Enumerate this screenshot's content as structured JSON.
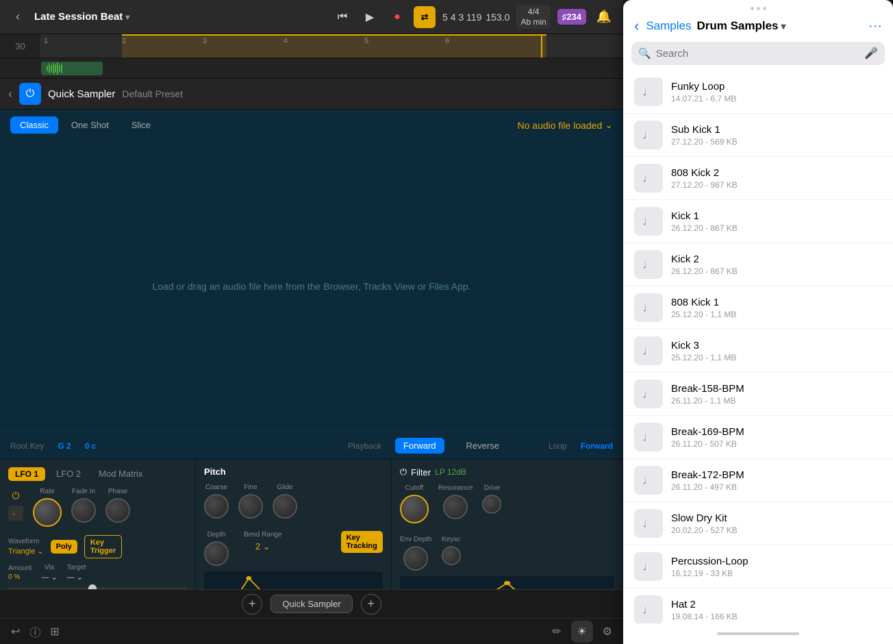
{
  "transport": {
    "back_label": "‹",
    "project_title": "Late Session Beat",
    "chevron": "▾",
    "rewind_icon": "⏮",
    "play_icon": "▶",
    "record_icon": "●",
    "loop_label": "⇄",
    "position": "5  4  3  119",
    "bpm": "153.0",
    "time_sig": "4/4\nAb min",
    "key_box": "♯234",
    "metronome_icon": "🔔"
  },
  "ruler": {
    "track_num": "30",
    "markers": [
      "1",
      "2",
      "3",
      "4",
      "5",
      "6"
    ]
  },
  "plugin": {
    "back_icon": "‹",
    "power_icon": "⏻",
    "name": "Quick Sampler",
    "preset": "Default Preset"
  },
  "sampler": {
    "tabs": [
      {
        "id": "classic",
        "label": "Classic",
        "active": true
      },
      {
        "id": "one-shot",
        "label": "One Shot",
        "active": false
      },
      {
        "id": "slice",
        "label": "Slice",
        "active": false
      }
    ],
    "no_audio": "No audio file loaded",
    "load_hint": "Load or drag an audio file here from the Browser, Tracks View or Files App.",
    "root_key_label": "Root Key",
    "root_key_value": "G 2",
    "tune_value": "0 c",
    "playback_label": "Playback",
    "forward_label": "Forward",
    "reverse_label": "Reverse",
    "loop_label": "Loop",
    "loop_value": "Forward"
  },
  "lfo": {
    "lfo1_label": "LFO 1",
    "lfo2_label": "LFO 2",
    "mod_matrix_label": "Mod Matrix",
    "rate_label": "Rate",
    "fade_in_label": "Fade In",
    "phase_label": "Phase",
    "waveform_label": "Waveform",
    "waveform_value": "Triangle",
    "poly_label": "Poly",
    "key_trigger_label": "Key\nTrigger",
    "amount_label": "Amount",
    "amount_value": "0 %",
    "via_label": "Via",
    "via_value": "—",
    "target_label": "Target",
    "target_value": "—"
  },
  "pitch": {
    "title": "Pitch",
    "coarse_label": "Coarse",
    "fine_label": "Fine",
    "glide_label": "Glide",
    "depth_label": "Depth",
    "bend_range_label": "Bend Range",
    "bend_range_value": "2",
    "key_tracking_label": "Key\nTracking"
  },
  "filter": {
    "title": "Filter",
    "type": "LP 12dB",
    "cutoff_label": "Cutoff",
    "resonance_label": "Resonance",
    "drive_label": "Drive",
    "env_depth_label": "Env Depth",
    "keysc_label": "Keysc"
  },
  "bottom_bar": {
    "add_left": "+",
    "track_label": "Quick Sampler",
    "add_right": "+",
    "undo_icon": "↩",
    "info_icon": "ⓘ",
    "layout_icon": "⊞",
    "pencil_icon": "✏",
    "brightness_icon": "☀",
    "eq_icon": "⚙"
  },
  "right_panel": {
    "dots": 3,
    "back_label": "Samples",
    "title": "Drum Samples",
    "title_chevron": "▾",
    "more_icon": "···",
    "search_placeholder": "Search",
    "mic_icon": "🎤",
    "samples": [
      {
        "name": "Funky Loop",
        "meta": "14.07.21 - 6,7 MB"
      },
      {
        "name": "Sub Kick 1",
        "meta": "27.12.20 - 569 KB"
      },
      {
        "name": "808 Kick 2",
        "meta": "27.12.20 - 987 KB"
      },
      {
        "name": "Kick 1",
        "meta": "26.12.20 - 867 KB"
      },
      {
        "name": "Kick 2",
        "meta": "26.12.20 - 867 KB"
      },
      {
        "name": "808 Kick 1",
        "meta": "25.12.20 - 1,1 MB"
      },
      {
        "name": "Kick 3",
        "meta": "25.12.20 - 1,1 MB"
      },
      {
        "name": "Break-158-BPM",
        "meta": "26.11.20 - 1,1 MB"
      },
      {
        "name": "Break-169-BPM",
        "meta": "26.11.20 - 507 KB"
      },
      {
        "name": "Break-172-BPM",
        "meta": "26.11.20 - 497 KB"
      },
      {
        "name": "Slow Dry Kit",
        "meta": "20.02.20 - 527 KB"
      },
      {
        "name": "Percussion-Loop",
        "meta": "16.12.19 - 33 KB"
      },
      {
        "name": "Hat 2",
        "meta": "19.08.14 - 166 KB"
      }
    ]
  }
}
